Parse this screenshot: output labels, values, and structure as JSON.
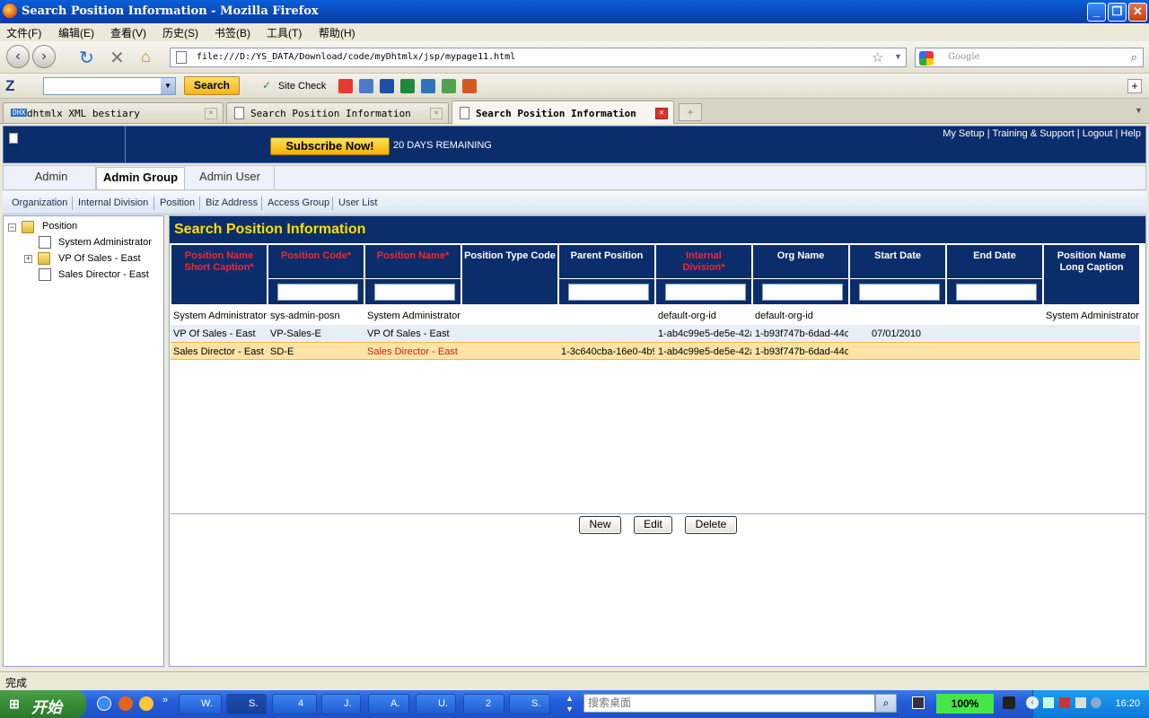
{
  "window": {
    "title": "Search Position Information - Mozilla Firefox"
  },
  "menu": [
    "文件(F)",
    "编辑(E)",
    "查看(V)",
    "历史(S)",
    "书签(B)",
    "工具(T)",
    "帮助(H)"
  ],
  "nav": {
    "url": "file:///D:/YS_DATA/Download/code/myDhtmlx/jsp/mypage11.html",
    "search_placeholder": "Google"
  },
  "toolbar": {
    "search_label": "Search",
    "site_check": "Site Check"
  },
  "tabs": [
    {
      "label": "dhtmlx XML bestiary",
      "badge": "DHX"
    },
    {
      "label": "Search Position Information"
    },
    {
      "label": "Search Position Information"
    }
  ],
  "header": {
    "subscribe_label": "Subscribe Now!",
    "days_remaining": "20 DAYS REMAINING",
    "links": [
      "My Setup",
      "Training & Support",
      "Logout",
      "Help"
    ]
  },
  "app_tabs": [
    "Admin",
    "Admin Group",
    "Admin User"
  ],
  "sub_nav": [
    "Organization",
    "Internal Division",
    "Position",
    "Biz Address",
    "Access Group",
    "User List"
  ],
  "tree": {
    "root": "Position",
    "children": [
      "System Administrator",
      "VP Of Sales - East",
      "Sales Director - East"
    ]
  },
  "main": {
    "title": "Search Position Information",
    "columns": [
      {
        "label": "Position Name Short Caption*",
        "required": true,
        "filter": false
      },
      {
        "label": "Position Code*",
        "required": true,
        "filter": true
      },
      {
        "label": "Position Name*",
        "required": true,
        "filter": true
      },
      {
        "label": "Position Type Code",
        "required": false,
        "filter": false
      },
      {
        "label": "Parent Position",
        "required": false,
        "filter": true
      },
      {
        "label": "Internal Division*",
        "required": true,
        "filter": true
      },
      {
        "label": "Org Name",
        "required": false,
        "filter": true
      },
      {
        "label": "Start Date",
        "required": false,
        "filter": true
      },
      {
        "label": "End Date",
        "required": false,
        "filter": true
      },
      {
        "label": "Position Name Long Caption",
        "required": false,
        "filter": false
      }
    ],
    "rows": [
      [
        "System Administrator",
        "sys-admin-posn",
        "System Administrator",
        "",
        "",
        "default-org-id",
        "default-org-id",
        "",
        "",
        "System Administrator"
      ],
      [
        "VP Of Sales - East",
        "VP-Sales-E",
        "VP Of Sales - East",
        "",
        "",
        "1-ab4c99e5-de5e-42a",
        "1-b93f747b-6dad-44c",
        "07/01/2010",
        "",
        ""
      ],
      [
        "Sales Director - East",
        "SD-E",
        "Sales Director - East",
        "",
        "1-3c640cba-16e0-4b9",
        "1-ab4c99e5-de5e-42a",
        "1-b93f747b-6dad-44c",
        "",
        "",
        ""
      ]
    ],
    "buttons": {
      "new": "New",
      "edit": "Edit",
      "delete": "Delete"
    }
  },
  "status": {
    "text": "完成"
  },
  "taskbar": {
    "start": "开始",
    "items": [
      "W.",
      "S.",
      "4",
      "J.",
      "A.",
      "U.",
      "2",
      "S."
    ],
    "desktop_search": "搜索桌面",
    "zoom": "100%",
    "clock": "16:20"
  },
  "colors": {
    "header_bg": "#0c2d6c",
    "title_yellow": "#ffdf00",
    "required_red": "#ff2222",
    "selected_row": "#fde4a6"
  }
}
